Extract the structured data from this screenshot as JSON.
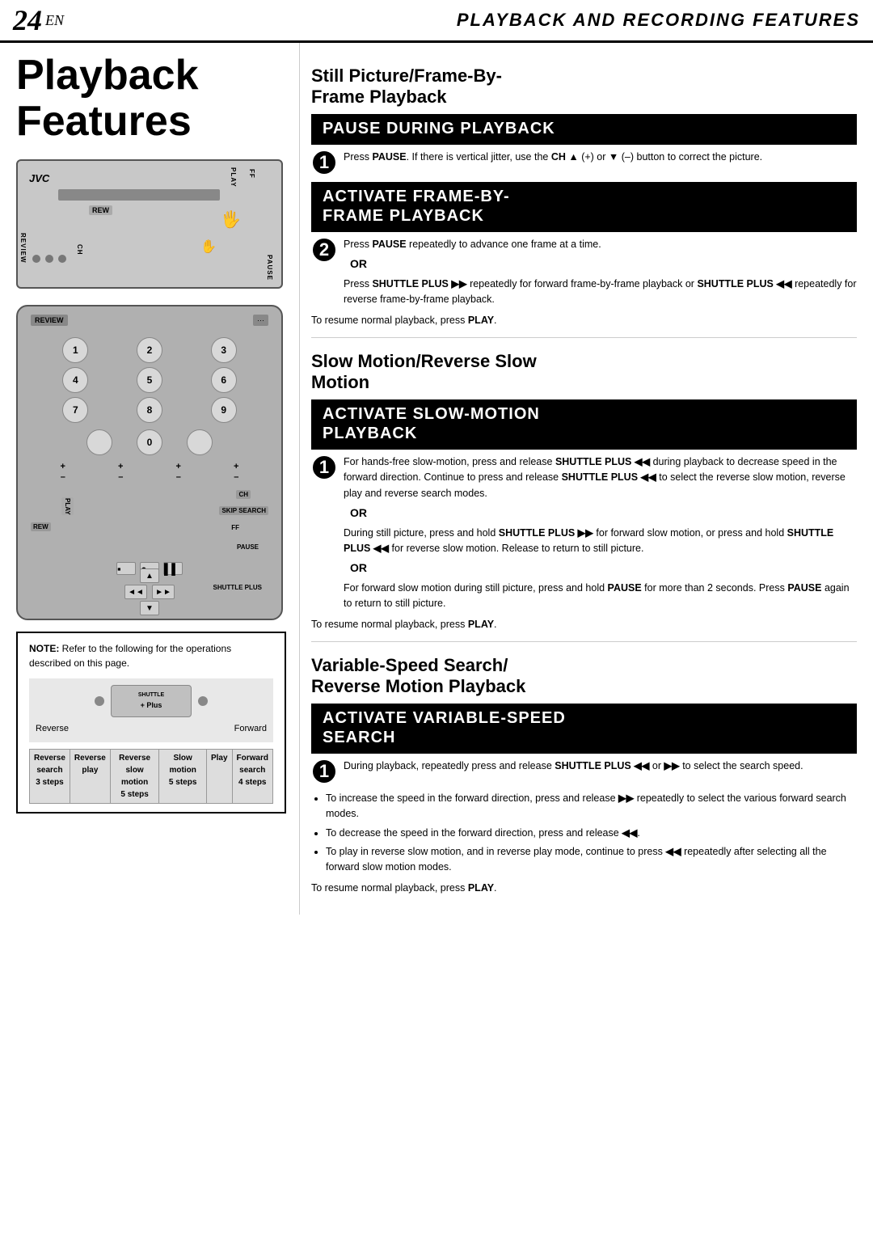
{
  "header": {
    "page_number": "24",
    "page_number_suffix": "EN",
    "title": "PLAYBACK AND RECORDING FEATURES"
  },
  "left_col": {
    "big_title": "Playback\nFeatures",
    "vcr": {
      "brand": "JVC",
      "label_rew": "REW",
      "label_ff": "FF",
      "label_pause": "PAUSE",
      "label_play": "PLAY",
      "label_review": "REVIEW",
      "label_ch": "CH"
    },
    "remote": {
      "label_review": "REVIEW",
      "buttons": [
        "1",
        "2",
        "3",
        "4",
        "5",
        "6",
        "7",
        "8",
        "9",
        "0"
      ],
      "label_ch": "CH",
      "label_skip_search": "SKIP SEARCH",
      "label_ff": "FF",
      "label_rew": "REW",
      "label_pause": "PAUSE",
      "label_play": "PLAY",
      "label_shuttle_plus": "SHUTTLE PLUS"
    },
    "note": {
      "label": "NOTE:",
      "text": " Refer to the following for the operations described on this page."
    },
    "shuttle_diagram": {
      "label": "SHUTTLE\n+ PLUS",
      "left_label": "Reverse",
      "right_label": "Forward",
      "table_headers": [
        "Reverse\nsearch\n3 steps",
        "Reverse\nplay",
        "Reverse\nslow motion\n5 steps",
        "Slow motion\n5 steps",
        "Play",
        "Forward\nsearch\n4 steps"
      ]
    }
  },
  "right_col": {
    "section1": {
      "heading": "Still Picture/Frame-By-\nFrame Playback",
      "step1_block_title": "PAUSE DURING PLAYBACK",
      "step1_number": "1",
      "step1_text": "Press PAUSE. If there is vertical jitter, use the CH ▲ (+) or ▼ (–) button to correct the picture.",
      "step2_block_title": "ACTIVATE FRAME-BY-\nFRAME PLAYBACK",
      "step2_number": "2",
      "step2_text_main": "Press PAUSE repeatedly to advance one frame at a time.",
      "step2_or": "OR",
      "step2_text_alt": "Press SHUTTLE PLUS ►► repeatedly for forward frame-by-frame playback or SHUTTLE PLUS ◄◄ repeatedly for reverse frame-by-frame playback.",
      "resume1": "To resume normal playback, press PLAY."
    },
    "section2": {
      "heading": "Slow Motion/Reverse Slow\nMotion",
      "step1_block_title": "ACTIVATE SLOW-MOTION\nPLAYBACK",
      "step1_number": "1",
      "step1_text": "For hands-free slow-motion, press and release SHUTTLE PLUS ◄◄ during playback to decrease speed in the forward direction. Continue to press and release SHUTTLE PLUS ◄◄ to select the reverse slow motion, reverse play and reverse search modes.",
      "step1_or1": "OR",
      "step1_text_alt1": "During still picture, press and hold SHUTTLE PLUS ►► for forward slow motion, or press and hold SHUTTLE PLUS ◄◄ for reverse slow motion. Release to return to still picture.",
      "step1_or2": "OR",
      "step1_text_alt2": "For forward slow motion during still picture, press and hold PAUSE for more than 2 seconds. Press PAUSE again to return to still picture.",
      "resume2": "To resume normal playback, press PLAY."
    },
    "section3": {
      "heading": "Variable-Speed Search/\nReverse Motion Playback",
      "step1_block_title": "ACTIVATE VARIABLE-SPEED\nSEARCH",
      "step1_number": "1",
      "step1_text": "During playback, repeatedly press and release SHUTTLE PLUS ◄◄ or ►► to select the search speed.",
      "bullets": [
        "To increase the speed in the forward direction, press and release ►► repeatedly to select the various forward search modes.",
        "To decrease the speed in the forward direction, press and release ◄◄.",
        "To play in reverse slow motion, and in reverse play mode, continue to press ◄◄ repeatedly after selecting all the forward slow motion modes."
      ],
      "resume3": "To resume normal playback, press PLAY."
    }
  }
}
